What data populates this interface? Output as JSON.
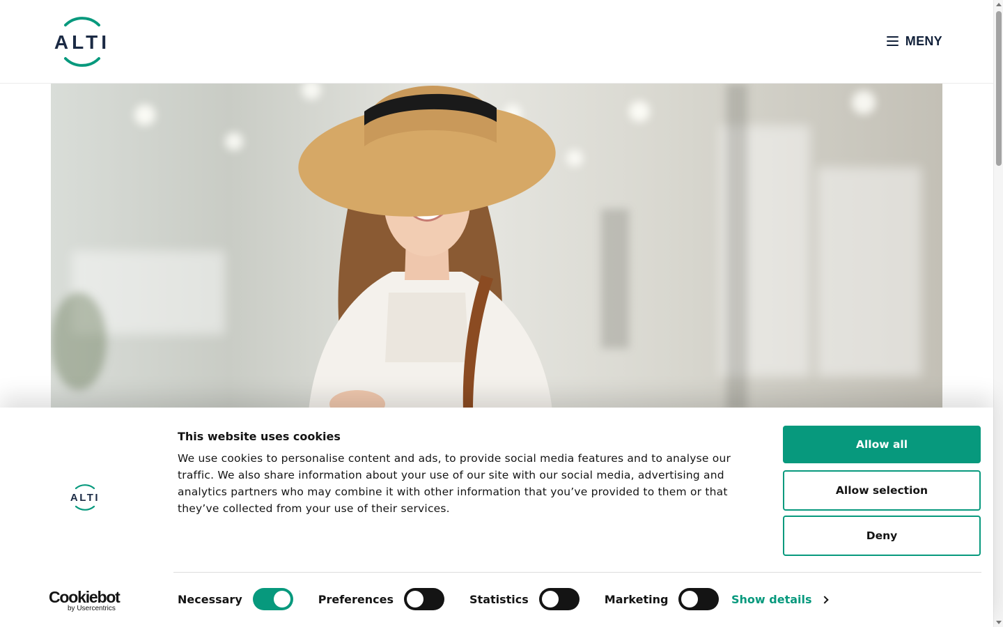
{
  "header": {
    "logo_text": "ALTI",
    "menu_label": "MENY",
    "menu_icon": "hamburger-icon"
  },
  "hero": {
    "image": "woman-in-straw-hat-photo"
  },
  "cookie_banner": {
    "logo_text": "ALTI",
    "title": "This website uses cookies",
    "body": "We use cookies to personalise content and ads, to provide social media features and to analyse our traffic. We also share information about your use of our site with our social media, advertising and analytics partners who may combine it with other information that you’ve provided to them or that they’ve collected from your use of their services.",
    "buttons": {
      "allow_all": "Allow all",
      "allow_selection": "Allow selection",
      "deny": "Deny"
    },
    "toggles": [
      {
        "label": "Necessary",
        "on": true
      },
      {
        "label": "Preferences",
        "on": false
      },
      {
        "label": "Statistics",
        "on": false
      },
      {
        "label": "Marketing",
        "on": false
      }
    ],
    "show_details": "Show details",
    "powered_by": {
      "brand": "Cookiebot",
      "by": "by Usercentrics"
    }
  },
  "colors": {
    "accent": "#07997d",
    "text": "#141414",
    "logo_navy": "#1b2a44"
  }
}
